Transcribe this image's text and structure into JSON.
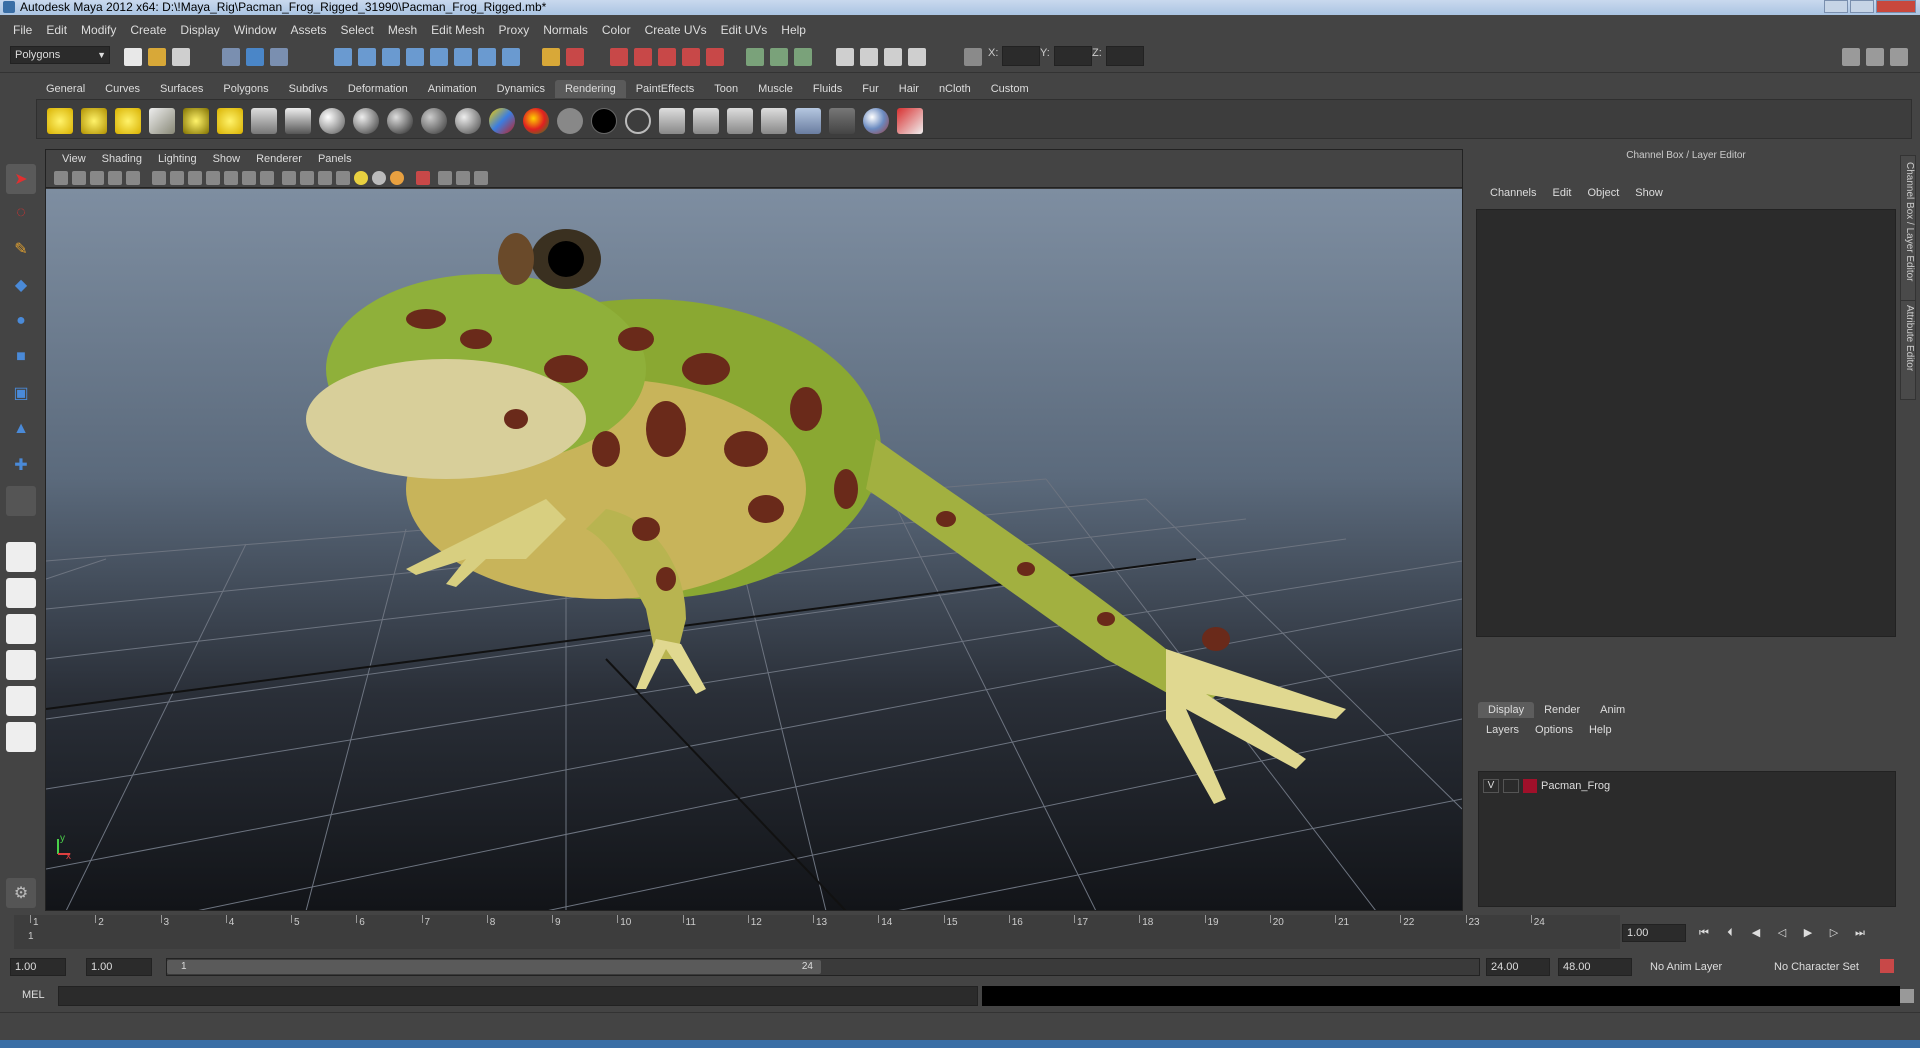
{
  "window": {
    "title": "Autodesk Maya 2012 x64: D:\\!Maya_Rig\\Pacman_Frog_Rigged_31990\\Pacman_Frog_Rigged.mb*"
  },
  "menubar": [
    "File",
    "Edit",
    "Modify",
    "Create",
    "Display",
    "Window",
    "Assets",
    "Select",
    "Mesh",
    "Edit Mesh",
    "Proxy",
    "Normals",
    "Color",
    "Create UVs",
    "Edit UVs",
    "Help"
  ],
  "statusline": {
    "mode": "Polygons",
    "x_label": "X:",
    "y_label": "Y:",
    "z_label": "Z:"
  },
  "shelf": {
    "tabs": [
      "General",
      "Curves",
      "Surfaces",
      "Polygons",
      "Subdivs",
      "Deformation",
      "Animation",
      "Dynamics",
      "Rendering",
      "PaintEffects",
      "Toon",
      "Muscle",
      "Fluids",
      "Fur",
      "Hair",
      "nCloth",
      "Custom"
    ],
    "active_tab": "Rendering"
  },
  "viewport": {
    "menu": [
      "View",
      "Shading",
      "Lighting",
      "Show",
      "Renderer",
      "Panels"
    ],
    "axis_x": "x",
    "axis_y": "y"
  },
  "channel_box": {
    "title": "Channel Box / Layer Editor",
    "menu": [
      "Channels",
      "Edit",
      "Object",
      "Show"
    ],
    "side_tab_1": "Channel Box / Layer Editor",
    "side_tab_2": "Attribute Editor"
  },
  "layer_editor": {
    "tabs": [
      "Display",
      "Render",
      "Anim"
    ],
    "active_tab": "Display",
    "menu": [
      "Layers",
      "Options",
      "Help"
    ],
    "layers": [
      {
        "visible": "V",
        "name": "Pacman_Frog",
        "color": "#a0102a"
      }
    ]
  },
  "timeline": {
    "ticks": [
      "1",
      "2",
      "3",
      "4",
      "5",
      "6",
      "7",
      "8",
      "9",
      "10",
      "11",
      "12",
      "13",
      "14",
      "15",
      "16",
      "17",
      "18",
      "19",
      "20",
      "21",
      "22",
      "23",
      "24"
    ],
    "current_frame": "1",
    "current_time_field": "1.00"
  },
  "range": {
    "start_time": "1.00",
    "playback_start": "1.00",
    "range_start_label": "1",
    "range_end_label": "24",
    "playback_end": "24.00",
    "end_time": "48.00",
    "anim_layer": "No Anim Layer",
    "character_set": "No Character Set"
  },
  "command_line": {
    "label": "MEL"
  },
  "colors": {
    "ui_bg": "#444444",
    "field_bg": "#2b2b2b",
    "accent_blue": "#3a6ea5"
  }
}
